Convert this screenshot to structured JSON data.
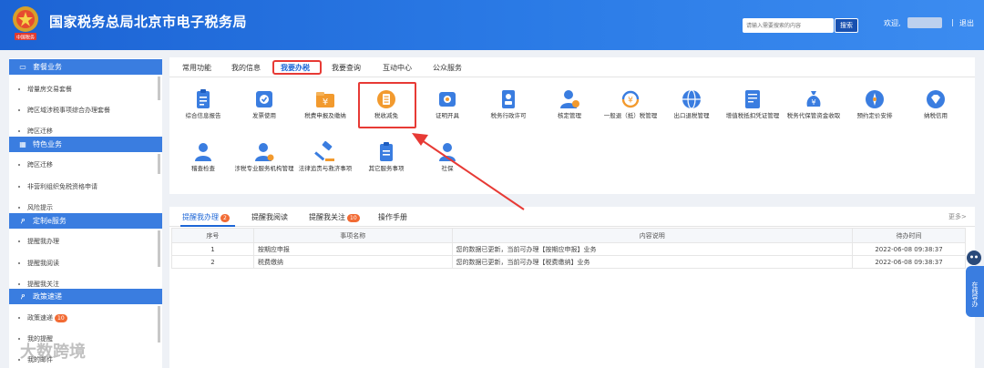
{
  "header": {
    "title": "国家税务总局北京市电子税务局",
    "emblem_text": "中国税务",
    "search_placeholder": "请输入需要搜索的内容",
    "search_button": "搜索",
    "welcome": "欢迎,",
    "separator": "|",
    "logout": "退出"
  },
  "sidebar": {
    "sections": [
      {
        "title": "套餐业务",
        "icon": "monitor-icon",
        "items": [
          "增量房交易套餐",
          "跨区域涉税事项综合办理套餐",
          "跨区迁移"
        ]
      },
      {
        "title": "特色业务",
        "icon": "grid-icon",
        "items": [
          "跨区迁移",
          "非营利组织免税资格申请",
          "风险提示"
        ]
      },
      {
        "title": "定制e服务",
        "icon": "user-icon",
        "items": [
          "提醒我办理",
          "提醒我阅读",
          "提醒我关注"
        ]
      },
      {
        "title": "政策速递",
        "icon": "user-icon",
        "items": [
          "政策速递",
          "我的提醒",
          "我的邮件"
        ],
        "badge": "10"
      }
    ]
  },
  "tabs": [
    "常用功能",
    "我的信息",
    "我要办税",
    "我要查询",
    "互动中心",
    "公众服务"
  ],
  "active_tab": "我要办税",
  "services": [
    {
      "label": "综合信息报告",
      "icon": "clipboard-icon",
      "color": "#3a7de0"
    },
    {
      "label": "发票使用",
      "icon": "invoice-icon",
      "color": "#3a7de0"
    },
    {
      "label": "税费申报及缴纳",
      "icon": "yuan-folder-icon",
      "color": "#f29a2e"
    },
    {
      "label": "税收减免",
      "icon": "tax-reduction-icon",
      "color": "#f29a2e"
    },
    {
      "label": "证明开具",
      "icon": "certificate-icon",
      "color": "#3a7de0"
    },
    {
      "label": "税务行政许可",
      "icon": "id-card-icon",
      "color": "#3a7de0"
    },
    {
      "label": "核定管理",
      "icon": "person-gear-icon",
      "color": "#3a7de0"
    },
    {
      "label": "一般退（抵）税管理",
      "icon": "refund-icon",
      "color": "#f29a2e"
    },
    {
      "label": "出口退税管理",
      "icon": "globe-icon",
      "color": "#3a7de0"
    },
    {
      "label": "增值税抵扣凭证管理",
      "icon": "ticket-icon",
      "color": "#3a7de0"
    },
    {
      "label": "税务代保管资金收取",
      "icon": "money-bag-icon",
      "color": "#3a7de0"
    },
    {
      "label": "预约定价安排",
      "icon": "compass-icon",
      "color": "#3a7de0"
    },
    {
      "label": "纳税信用",
      "icon": "diamond-icon",
      "color": "#3a7de0"
    },
    {
      "label": "稽查检查",
      "icon": "person-icon",
      "color": "#3a7de0"
    },
    {
      "label": "涉税专业服务机构管理",
      "icon": "person-badge-icon",
      "color": "#3a7de0"
    },
    {
      "label": "法律追责与救济事项",
      "icon": "gavel-icon",
      "color": "#3a7de0"
    },
    {
      "label": "其它服务事项",
      "icon": "list-icon",
      "color": "#3a7de0"
    },
    {
      "label": "社保",
      "icon": "person-icon",
      "color": "#3a7de0"
    }
  ],
  "bottom_tabs": [
    {
      "label": "提醒我办理",
      "count": "2",
      "count_color": "#f26b34"
    },
    {
      "label": "提醒我阅读",
      "count": "",
      "count_color": ""
    },
    {
      "label": "提醒我关注",
      "count": "10",
      "count_color": "#f26b34"
    },
    {
      "label": "操作手册",
      "count": "",
      "count_color": ""
    }
  ],
  "more": "更多>",
  "table": {
    "headers": [
      "序号",
      "事项名称",
      "内容说明",
      "待办时间"
    ],
    "rows": [
      [
        "1",
        "按期应申报",
        "您的数据已更新，当前可办理【按期应申报】业务",
        "2022-06-08 09:38:37"
      ],
      [
        "2",
        "税费缴纳",
        "您的数据已更新，当前可办理【税费缴纳】业务",
        "2022-06-08 09:38:37"
      ]
    ]
  },
  "float_widget": "在线导办",
  "watermark": "大数跨境",
  "colors": {
    "brand_blue": "#1d66d6",
    "highlight_red": "#e73a35",
    "sidebar_head": "#3a7de0"
  }
}
